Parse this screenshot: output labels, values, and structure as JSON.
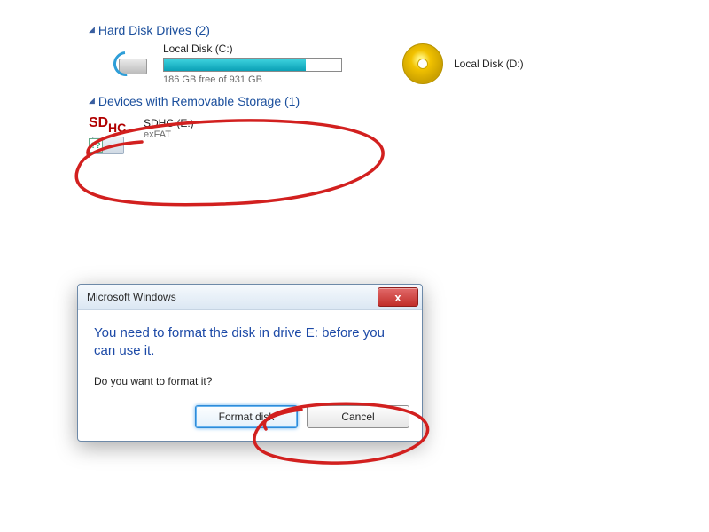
{
  "sections": {
    "hdd_header": "Hard Disk Drives (2)",
    "removable_header": "Devices with Removable Storage (1)"
  },
  "drives": {
    "c": {
      "name": "Local Disk (C:)",
      "free_text": "186 GB free of 931 GB"
    },
    "d": {
      "name": "Local Disk (D:)"
    },
    "e": {
      "name": "SDHC (E:)",
      "fs": "exFAT",
      "badge1": "SD",
      "badge2": "HC",
      "qmark": "??"
    }
  },
  "dialog": {
    "title": "Microsoft Windows",
    "close_glyph": "x",
    "message": "You need to format the disk in drive E: before you can use it.",
    "question": "Do you want to format it?",
    "format_label": "Format disk",
    "cancel_label": "Cancel"
  }
}
